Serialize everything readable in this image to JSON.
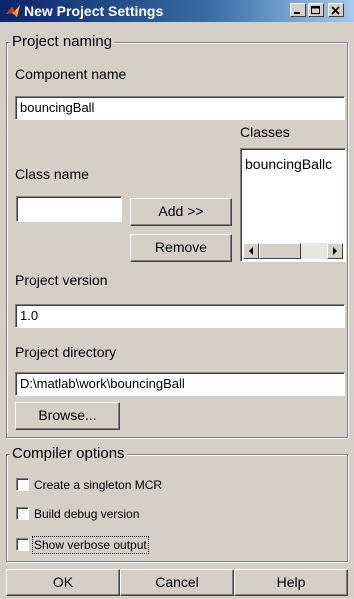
{
  "window": {
    "title": "New Project Settings",
    "icon": "matlab-icon"
  },
  "project_naming": {
    "legend": "Project naming",
    "component_name_label": "Component name",
    "component_name_value": "bouncingBall",
    "classes_label": "Classes",
    "classes_items": [
      "bouncingBallc"
    ],
    "class_name_label": "Class name",
    "class_name_value": "",
    "add_button": "Add >>",
    "remove_button": "Remove",
    "project_version_label": "Project version",
    "project_version_value": "1.0",
    "project_directory_label": "Project directory",
    "project_directory_value": "D:\\matlab\\work\\bouncingBall",
    "browse_button": "Browse..."
  },
  "compiler_options": {
    "legend": "Compiler options",
    "options": [
      {
        "label": "Create a singleton MCR",
        "checked": false
      },
      {
        "label": "Build debug version",
        "checked": false
      },
      {
        "label": "Show verbose output",
        "checked": false
      }
    ]
  },
  "footer": {
    "ok": "OK",
    "cancel": "Cancel",
    "help": "Help"
  }
}
